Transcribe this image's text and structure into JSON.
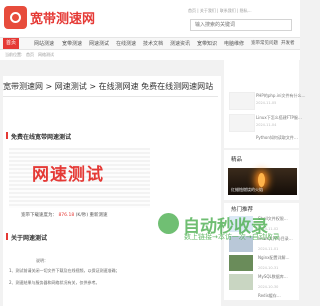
{
  "header": {
    "site_name": "宽带测速网",
    "search_placeholder": "输入搜索的关键词"
  },
  "top_links": [
    "首页",
    "关于我们",
    "联系我们",
    "隐私…"
  ],
  "nav": [
    {
      "label": "首页"
    },
    {
      "label": "网站测速"
    },
    {
      "label": "宽带测速"
    },
    {
      "label": "网速测试"
    },
    {
      "label": "在线测速"
    },
    {
      "label": "技术文档"
    },
    {
      "label": "测速资讯"
    },
    {
      "label": "宽带知识"
    },
    {
      "label": "电脑维修"
    },
    {
      "label": "宽带常见问题"
    },
    {
      "label": "开发者"
    }
  ],
  "breadcrumb": [
    "当前位置:",
    "首页",
    "网络测试"
  ],
  "article": {
    "title": "宽带测速网 > 网速测试 > 在线测网速 免费在线测网速网站",
    "section1": "免费在线宽带网速测试",
    "image_text": "网速测试",
    "caption_prefix": "宽带下载速度为：",
    "caption_value": "876.18",
    "caption_suffix": "(K/秒) 重新测速",
    "section2": "关于网速测试",
    "intro_label": "说明：",
    "line1": "1、测试前请关闭一切文件下载及在线视频，以保证测速准确；",
    "line2": "2、测速结果与服务器和网络状况有关，仅供参考。"
  },
  "sidebar": {
    "latest": [
      {
        "title": "PHP的php.ini文件有什么…",
        "time": "2024-11-05"
      },
      {
        "title": "Linux下怎么搭建FTP服…",
        "time": "2024-11-04"
      },
      {
        "title": "Python如何读取文件…",
        "time": "2024-11-03"
      }
    ],
    "featured_title": "精品",
    "featured_caption": "红蜡烛燃烧的火焰",
    "hot_title": "热门推荐",
    "hot": [
      {
        "title": "Shell文件权限…",
        "time": "2024-11-02"
      },
      {
        "title": "Linux文件与目录…",
        "time": "2024-11-01"
      },
      {
        "title": "Nginx配置详解…",
        "time": "2024-10-31"
      },
      {
        "title": "MySQL数据库…",
        "time": "2024-10-30"
      },
      {
        "title": "Redis缓存…",
        "time": "2024-10-29"
      }
    ]
  },
  "watermark": {
    "main": "自动秒收录",
    "sub": "数上链接→本访一次→自动收录"
  },
  "colors": {
    "accent": "#e53935",
    "watermark": "#4caf50"
  }
}
